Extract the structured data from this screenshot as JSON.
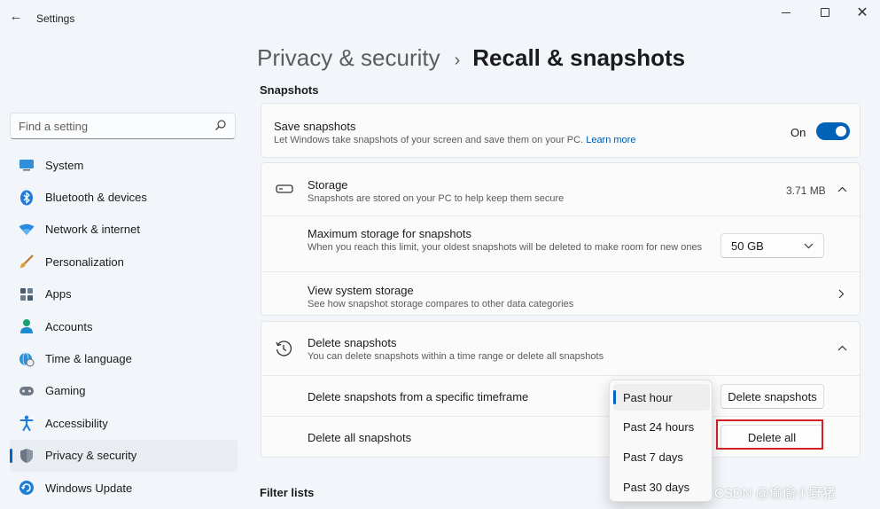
{
  "window": {
    "title": "Settings",
    "controls": [
      "minimize",
      "maximize",
      "close"
    ]
  },
  "sidebar": {
    "search_placeholder": "Find a setting",
    "items": [
      {
        "label": "System",
        "icon": "system-icon"
      },
      {
        "label": "Bluetooth & devices",
        "icon": "bluetooth-icon"
      },
      {
        "label": "Network & internet",
        "icon": "wifi-icon"
      },
      {
        "label": "Personalization",
        "icon": "brush-icon"
      },
      {
        "label": "Apps",
        "icon": "apps-icon"
      },
      {
        "label": "Accounts",
        "icon": "accounts-icon"
      },
      {
        "label": "Time & language",
        "icon": "globe-clock-icon"
      },
      {
        "label": "Gaming",
        "icon": "gamepad-icon"
      },
      {
        "label": "Accessibility",
        "icon": "accessibility-icon"
      },
      {
        "label": "Privacy & security",
        "icon": "shield-icon",
        "active": true
      },
      {
        "label": "Windows Update",
        "icon": "windows-update-icon"
      }
    ]
  },
  "breadcrumb": {
    "parent": "Privacy & security",
    "separator": "›",
    "current": "Recall & snapshots"
  },
  "sections": {
    "snapshots": "Snapshots",
    "filter_lists": "Filter lists"
  },
  "save_snapshots": {
    "title": "Save snapshots",
    "desc": "Let Windows take snapshots of your screen and save them on your PC.",
    "link": "Learn more",
    "toggle_label": "On",
    "toggle_on": true
  },
  "storage": {
    "title": "Storage",
    "desc": "Snapshots are stored on your PC to help keep them secure",
    "size": "3.71 MB",
    "max_title": "Maximum storage for snapshots",
    "max_desc": "When you reach this limit, your oldest snapshots will be deleted to make room for new ones",
    "max_value": "50 GB",
    "system_title": "View system storage",
    "system_desc": "See how snapshot storage compares to other data categories"
  },
  "delete": {
    "title": "Delete snapshots",
    "desc": "You can delete snapshots within a time range or delete all snapshots",
    "timeframe_label": "Delete snapshots from a specific timeframe",
    "timeframe_button": "Delete snapshots",
    "all_label": "Delete all snapshots",
    "all_button": "Delete all"
  },
  "timeframe_dropdown": {
    "options": [
      "Past hour",
      "Past 24 hours",
      "Past 7 days",
      "Past 30 days"
    ],
    "selected": "Past hour"
  },
  "watermark": "CSDN @偷偷小野猪",
  "colors": {
    "accent": "#0063b7",
    "highlight": "#d32027",
    "background": "#f2f5fa",
    "card": "#fbfbfc"
  }
}
